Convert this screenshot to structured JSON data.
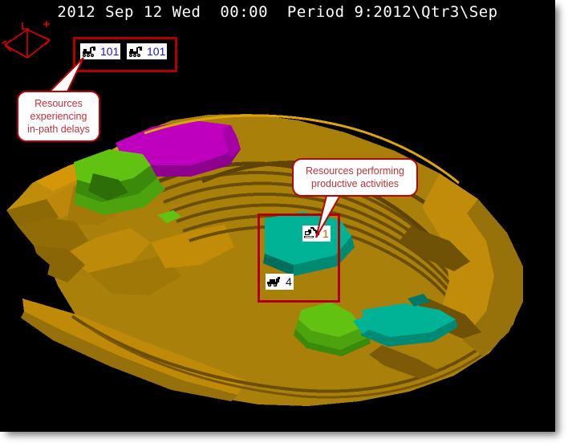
{
  "window": {
    "title_bar": "2012 Sep 12 Wed  00:00  Period 9:2012\\Qtr3\\Sep",
    "background_color": "#000000"
  },
  "simulation": {
    "date_year": "2012",
    "date_month": "Sep",
    "date_day": "12",
    "date_weekday": "Wed",
    "clock": "00:00",
    "period_label": "Period 9:2012\\Qtr3\\Sep"
  },
  "axis_indicator": {
    "name": "orientation-axis-triad",
    "color": "#E00000",
    "labels": [
      "Z",
      "X",
      "Y"
    ]
  },
  "highlights": [
    {
      "id": "delays",
      "name": "in-path-delay-group",
      "border_color": "#B20000",
      "callout_text_line1": "Resources",
      "callout_text_line2": "experiencing",
      "callout_text_line3": "in-path delays",
      "callout_color": "#C0303C"
    },
    {
      "id": "productive",
      "name": "productive-activity-group",
      "border_color": "#B20000",
      "callout_text_line1": "Resources performing",
      "callout_text_line2": "productive activities",
      "callout_color": "#C0303C"
    }
  ],
  "resources": [
    {
      "id": "truck-a",
      "icon": "haul-truck-icon",
      "count": "101",
      "count_color": "#1414C8",
      "group": "delays"
    },
    {
      "id": "truck-b",
      "icon": "haul-truck-icon",
      "count": "101",
      "count_color": "#1414C8",
      "group": "delays"
    },
    {
      "id": "shovel",
      "icon": "shovel-icon",
      "count": "1",
      "count_color": "#D05A00",
      "group": "productive"
    },
    {
      "id": "loader",
      "icon": "loader-icon",
      "count": "4",
      "count_color": "#101030",
      "group": "productive"
    }
  ],
  "terrain": {
    "name": "open-pit-mine-mesh",
    "palette": {
      "rock_light": "#D99A08",
      "rock_mid": "#BE8409",
      "rock_main": "#A8800A",
      "rock_dark": "#8A6406",
      "bench_line": "#6B4E08",
      "shadow": "#5A4105",
      "ore_magenta": "#BE00BE",
      "ore_magenta_dark": "#8E008E",
      "ore_green": "#62C212",
      "ore_green_dark": "#3C8A0C",
      "ore_teal": "#00B296",
      "ore_teal_dark": "#008A74",
      "void_black": "#000000"
    },
    "legend_zones": [
      {
        "name": "magenta-ore-block",
        "color": "#BE00BE"
      },
      {
        "name": "green-ore-block",
        "color": "#62C212"
      },
      {
        "name": "teal-ore-block",
        "color": "#00B296"
      },
      {
        "name": "waste-rock",
        "color": "#A8800A"
      }
    ]
  }
}
